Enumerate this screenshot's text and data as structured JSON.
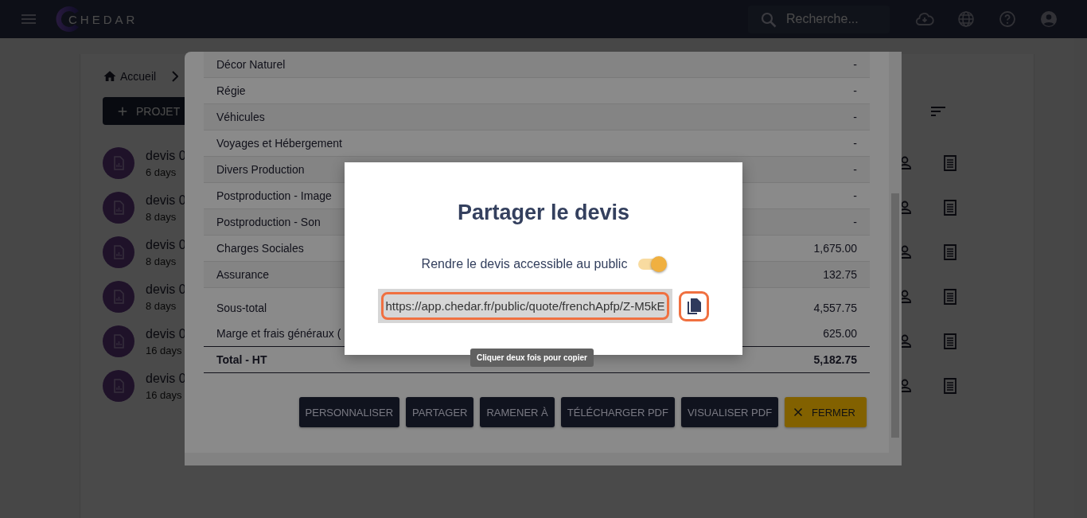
{
  "top_bar": {
    "logo": "CHEDAR",
    "search": {
      "placeholder": "Recherche..."
    }
  },
  "page": {
    "breadcrumb": [
      "Accueil"
    ],
    "new_button": "PROJET",
    "items": [
      {
        "title": "devis 0",
        "age": "6 days"
      },
      {
        "title": "devis 0",
        "age": "8 days"
      },
      {
        "title": "devis 0",
        "age": "8 days"
      },
      {
        "title": "devis 0",
        "age": "8 days"
      },
      {
        "title": "devis 0",
        "age": "16 days"
      },
      {
        "title": "devis 0",
        "age": "16 days"
      }
    ]
  },
  "quote_dialog": {
    "rows": [
      {
        "label": "Décor Naturel",
        "value": "-"
      },
      {
        "label": "Régie",
        "value": "-"
      },
      {
        "label": "Véhicules",
        "value": "-"
      },
      {
        "label": "Voyages et Hébergement",
        "value": "-"
      },
      {
        "label": "Divers Production",
        "value": "-"
      },
      {
        "label": "Postproduction - Image",
        "value": "-"
      },
      {
        "label": "Postproduction - Son",
        "value": "-"
      },
      {
        "label": "Charges Sociales",
        "value": "1,675.00"
      },
      {
        "label": "Assurance",
        "value": "132.75"
      }
    ],
    "totals": [
      {
        "kind": "plain",
        "label": "Sous-total",
        "value": "4,557.75"
      },
      {
        "kind": "plain",
        "label": "Marge et frais généraux (",
        "value": "625.00"
      },
      {
        "kind": "total",
        "label": "Total - HT",
        "value": "5,182.75"
      }
    ],
    "buttons": [
      {
        "kind": "action",
        "label": "PERSONNALISER"
      },
      {
        "kind": "action",
        "label": "PARTAGER"
      },
      {
        "kind": "action",
        "label": "RAMENER À"
      },
      {
        "kind": "action",
        "label": "TÉLÉCHARGER PDF"
      },
      {
        "kind": "action",
        "label": "VISUALISER PDF"
      },
      {
        "kind": "close",
        "label": "FERMER"
      }
    ]
  },
  "share_dialog": {
    "title": "Partager le devis",
    "public_label": "Rendre le devis accessible au public",
    "public_on": true,
    "url": "https://app.chedar.fr/public/quote/frenchApfp/Z-M5kE",
    "tooltip": "Cliquer deux fois pour copier"
  }
}
